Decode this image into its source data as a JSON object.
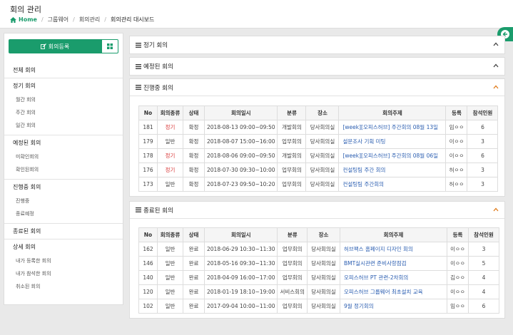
{
  "header": {
    "title": "회의 관리",
    "breadcrumb": [
      "Home",
      "그룹웨어",
      "회의관리",
      "회의관리 대시보드"
    ]
  },
  "sidebar": {
    "register_label": "회의등록",
    "groups": [
      {
        "label": "전체 회의",
        "items": []
      },
      {
        "label": "정기 회의",
        "items": [
          "월간 회의",
          "주간 회의",
          "일간 회의"
        ]
      },
      {
        "label": "예정된 회의",
        "items": [
          "미확인회의",
          "확인된회의"
        ]
      },
      {
        "label": "진행중 회의",
        "items": [
          "진행중",
          "종료예정"
        ]
      },
      {
        "label": "종료된 회의",
        "items": []
      },
      {
        "label": "상세 회의",
        "items": [
          "내가 등록한 회의",
          "내가 참석한 회의",
          "취소된 회의"
        ]
      }
    ]
  },
  "panels": {
    "regular": {
      "title": "정기 회의"
    },
    "scheduled": {
      "title": "예정된 회의"
    },
    "ongoing": {
      "title": "진행중 회의"
    },
    "finished": {
      "title": "종료된 회의"
    }
  },
  "columns": [
    "No",
    "회의종류",
    "상태",
    "회의일시",
    "분류",
    "장소",
    "회의주제",
    "등록",
    "참석인원"
  ],
  "ongoing_rows": [
    {
      "no": "181",
      "kind": "정기",
      "status": "확정",
      "datetime": "2018-08-13 09:00~09:50",
      "cat": "개발회의",
      "place": "당사회의실",
      "subject": "[week][오피스허브] 주간회의 08월 13일",
      "reg": "임ㅇㅇ",
      "count": "6",
      "red": true
    },
    {
      "no": "179",
      "kind": "일반",
      "status": "확정",
      "datetime": "2018-08-07 15:00~16:00",
      "cat": "업무회의",
      "place": "당사회의실",
      "subject": "설문조사 기획 미팅",
      "reg": "이ㅇㅇ",
      "count": "3",
      "red": false
    },
    {
      "no": "178",
      "kind": "정기",
      "status": "확정",
      "datetime": "2018-08-06 09:00~09:50",
      "cat": "개발회의",
      "place": "당사회의실",
      "subject": "[week][오피스허브] 주간회의 08월 06일",
      "reg": "이ㅇㅇ",
      "count": "6",
      "red": true
    },
    {
      "no": "176",
      "kind": "정기",
      "status": "확정",
      "datetime": "2018-07-30 09:30~10:00",
      "cat": "업무회의",
      "place": "당사회의실",
      "subject": "컨설팅팀 주간 회의",
      "reg": "허ㅇㅇ",
      "count": "3",
      "red": true
    },
    {
      "no": "173",
      "kind": "일반",
      "status": "확정",
      "datetime": "2018-07-23 09:50~10:20",
      "cat": "업무회의",
      "place": "당사회의실",
      "subject": "컨설팅팀 주간회의",
      "reg": "허ㅇㅇ",
      "count": "3",
      "red": false
    }
  ],
  "finished_rows": [
    {
      "no": "162",
      "kind": "일반",
      "status": "완료",
      "datetime": "2018-06-29 10:30~11:30",
      "cat": "업무회의",
      "place": "당사회의실",
      "subject": "허브팩스 홈페이지 디자인 회의",
      "reg": "이ㅇㅇ",
      "count": "3"
    },
    {
      "no": "146",
      "kind": "일반",
      "status": "완료",
      "datetime": "2018-05-16 09:30~11:30",
      "cat": "업무회의",
      "place": "당사회의실",
      "subject": "BMT실시관련 준비사항점검",
      "reg": "이ㅇㅇ",
      "count": "5"
    },
    {
      "no": "140",
      "kind": "일반",
      "status": "완료",
      "datetime": "2018-04-09 16:00~17:00",
      "cat": "업무회의",
      "place": "당사회의실",
      "subject": "오피스허브 PT 관련-2차회의",
      "reg": "김ㅇㅇ",
      "count": "4"
    },
    {
      "no": "120",
      "kind": "일반",
      "status": "완료",
      "datetime": "2018-01-19 18:10~19:00",
      "cat": "서비스회의",
      "place": "당사회의실",
      "subject": "오피스허브 그룹웨어 최초설치 교육",
      "reg": "이ㅇㅇ",
      "count": "4"
    },
    {
      "no": "102",
      "kind": "일반",
      "status": "완료",
      "datetime": "2017-09-04 10:00~11:00",
      "cat": "업무회의",
      "place": "당사회의실",
      "subject": "9월 정기회의",
      "reg": "임ㅇㅇ",
      "count": "6"
    }
  ]
}
